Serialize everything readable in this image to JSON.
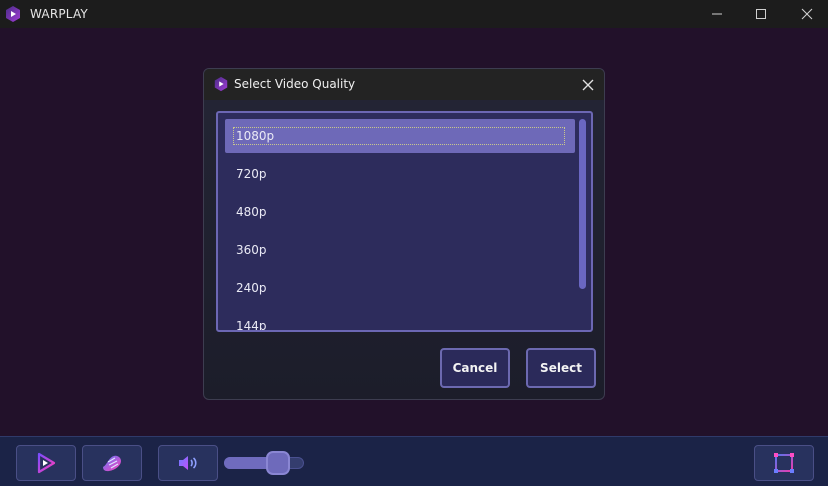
{
  "window": {
    "title": "WARPLAY"
  },
  "dialog": {
    "title": "Select Video Quality",
    "items": [
      "1080p",
      "720p",
      "480p",
      "360p",
      "240p",
      "144p"
    ],
    "selected_index": 0,
    "cancel_label": "Cancel",
    "select_label": "Select"
  },
  "controls": {
    "volume_fraction": 0.75
  },
  "colors": {
    "accent": "#6e69b8",
    "list_background": "#2d2c5c",
    "control_bar": "#1b2347",
    "icon_gradient_start": "#7a4dff",
    "icon_gradient_end": "#ff3db8"
  },
  "icons": {
    "app": "warplay-logo-icon",
    "minimize": "minimize-icon",
    "maximize": "maximize-icon",
    "close": "close-icon",
    "play": "play-icon",
    "stream": "stream-icon",
    "volume": "volume-icon",
    "fullscreen": "fullscreen-icon"
  }
}
